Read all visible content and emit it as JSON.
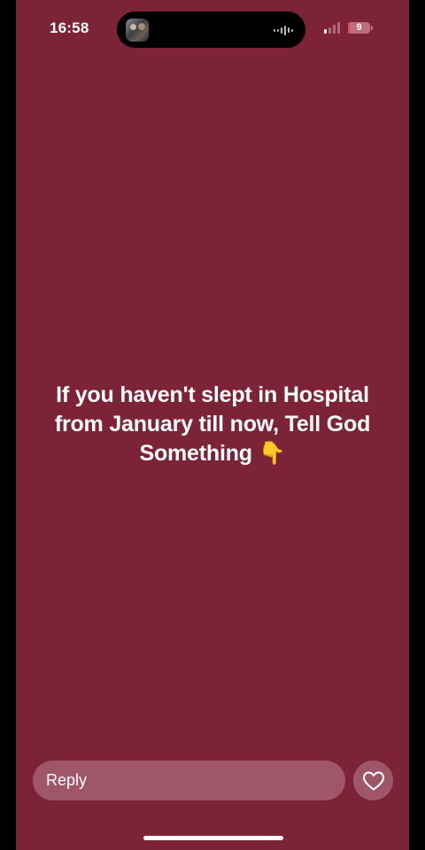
{
  "status_bar": {
    "time": "16:58",
    "battery_level": "9",
    "battery_percent": 9,
    "signal_bars_active": 1,
    "signal_bars_total": 4
  },
  "dynamic_island": {
    "activity": "audio-playing",
    "thumbnail_icon": "album-art-thumbnail",
    "waveform_icon": "waveform-icon"
  },
  "story": {
    "background_color": "#7c2338",
    "text": "If you haven't slept in Hospital from January till now, Tell God Something 👇"
  },
  "reply": {
    "placeholder": "Reply",
    "like_icon": "heart-icon"
  },
  "colors": {
    "story_background": "#7c2338",
    "control_background": "#a0566a",
    "battery_low": "#e0475e"
  }
}
